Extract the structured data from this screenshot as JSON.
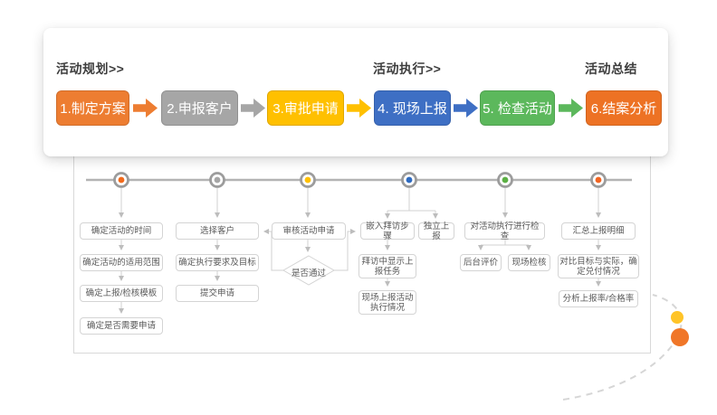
{
  "header_card": {
    "sections": [
      {
        "label": "活动规划>>"
      },
      {
        "label": "活动执行>>"
      },
      {
        "label": "活动总结"
      }
    ],
    "steps": [
      {
        "label": "1.制定方案",
        "color": "#ED7D31"
      },
      {
        "label": "2.申报客户",
        "color": "#A6A6A6"
      },
      {
        "label": "3.审批申请",
        "color": "#FFC000"
      },
      {
        "label": "4. 现场上报",
        "color": "#3E6FC4"
      },
      {
        "label": "5. 检查活动",
        "color": "#5CB85C"
      },
      {
        "label": "6.结案分析",
        "color": "#ED7224"
      }
    ]
  },
  "flowchart": {
    "timeline_dot_colors": [
      "#F26A1B",
      "#A6A6A6",
      "#FFC000",
      "#2F6BC0",
      "#5CB044",
      "#F26522"
    ],
    "columns": [
      {
        "boxes": [
          "确定活动的时间",
          "确定活动的适用范围",
          "确定上报/检核模板",
          "确定是否需要申请"
        ]
      },
      {
        "boxes": [
          "选择客户",
          "确定执行要求及目标",
          "提交申请"
        ]
      },
      {
        "boxes": [
          "审核活动申请"
        ],
        "decision": "是否通过"
      },
      {
        "boxes": [
          "嵌入拜访步骤",
          "独立上报",
          "拜访中显示上报任务",
          "现场上报活动执行情况"
        ]
      },
      {
        "boxes": [
          "对活动执行进行检查",
          "后台评价",
          "现场检核"
        ]
      },
      {
        "boxes": [
          "汇总上报明细",
          "对比目标与实际，确定兑付情况",
          "分析上报率/合格率"
        ]
      }
    ]
  },
  "decoration": {
    "small_dot_color": "#FFC428",
    "large_dot_color": "#F07628"
  }
}
